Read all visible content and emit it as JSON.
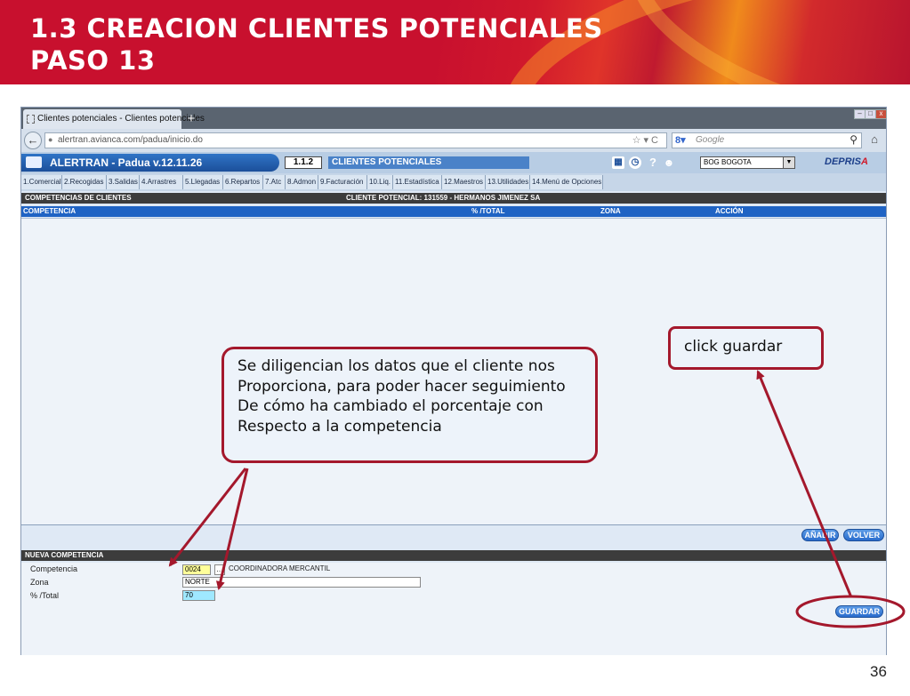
{
  "slide": {
    "title_line1": "1.3 CREACION CLIENTES POTENCIALES",
    "title_line2": "PASO 13",
    "page_number": "36"
  },
  "browser": {
    "tab_title": "Clientes potenciales - Clientes potenciales",
    "new_tab": "+",
    "url": "alertran.avianca.com/padua/inicio.do",
    "search_placeholder": "Google"
  },
  "app": {
    "name": "ALERTRAN - Padua  v.12.11.26",
    "module_code": "1.1.2",
    "module_name": "CLIENTES POTENCIALES",
    "branch": "BOG BOGOTA",
    "logo": "DEPRIS",
    "logo_accent": "A"
  },
  "menu": [
    "1.Comercial",
    "2.Recogidas",
    "3.Salidas",
    "4.Arrastres",
    "5.Llegadas",
    "6.Repartos",
    "7.Atc",
    "8.Admon",
    "9.Facturación",
    "10.Liq.",
    "11.Estadística",
    "12.Maestros",
    "13.Utilidades",
    "14.Menú de Opciones"
  ],
  "competencias": {
    "section_title": "COMPETENCIAS DE CLIENTES",
    "client_label": "CLIENTE POTENCIAL: 131559 - HERMANOS JIMENEZ SA",
    "columns": [
      "COMPETENCIA",
      "% /TOTAL",
      "ZONA",
      "ACCIÓN"
    ],
    "add_button": "AÑADIR",
    "back_button": "VOLVER"
  },
  "nueva": {
    "section_title": "NUEVA COMPETENCIA",
    "competencia_label": "Competencia",
    "competencia_code": "0024",
    "competencia_name": "COORDINADORA MERCANTIL",
    "zona_label": "Zona",
    "zona_value": "NORTE",
    "total_label": "% /Total",
    "total_value": "70",
    "save_button": "GUARDAR"
  },
  "annotations": {
    "main_lines": [
      "Se diligencian los datos que el cliente nos",
      "Proporciona, para poder hacer seguimiento",
      "De cómo ha cambiado el porcentaje con",
      "Respecto a la competencia"
    ],
    "save_note": "click guardar"
  },
  "colors": {
    "annotation_border": "#a4182c",
    "header_red": "#c8102e",
    "app_blue": "#1f63c4"
  }
}
